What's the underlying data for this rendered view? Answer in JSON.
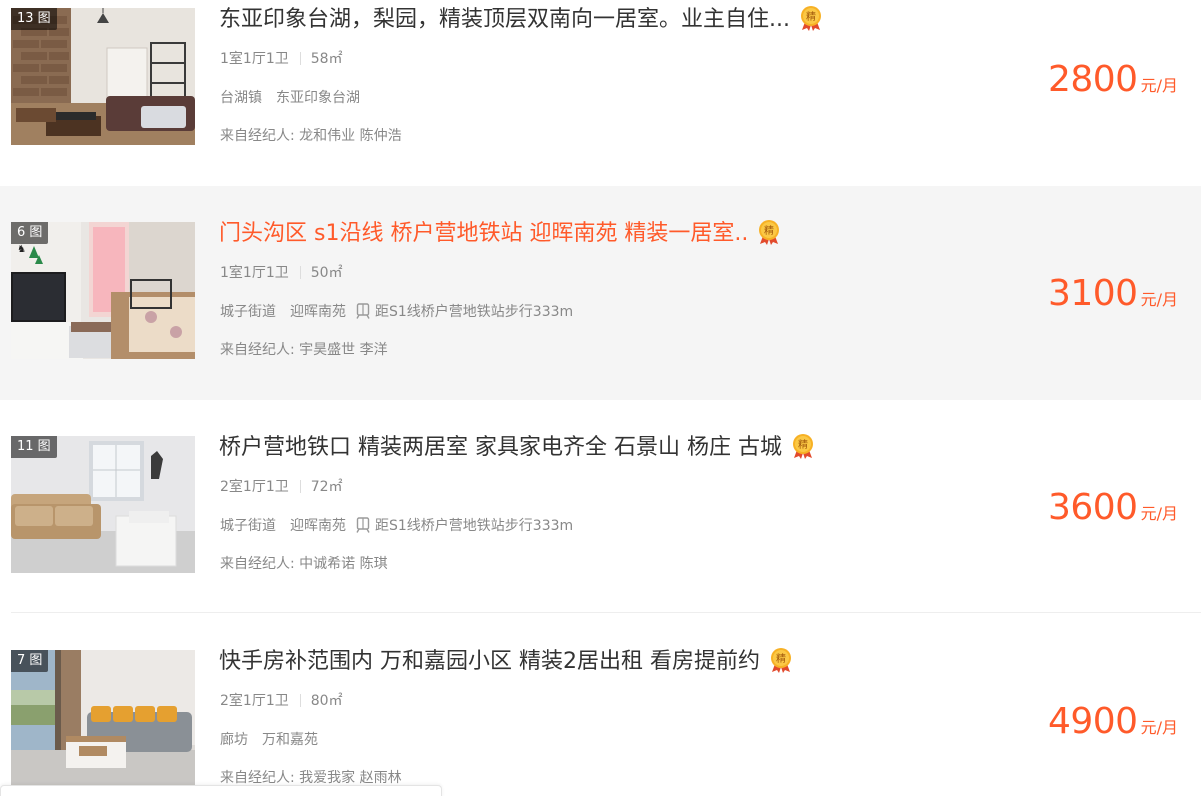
{
  "listings": [
    {
      "pic_count": "13 图",
      "title": "东亚印象台湖，梨园，精装顶层双南向一居室。业主自住...",
      "layout": "1室1厅1卫",
      "area": "58㎡",
      "location": [
        "台湖镇",
        "东亚印象台湖"
      ],
      "subway": "",
      "agent": "来自经纪人: 龙和伟业 陈仲浩",
      "price": "2800",
      "price_unit": "元/月",
      "badge": "精"
    },
    {
      "pic_count": "6 图",
      "title": "门头沟区 s1沿线 桥户营地铁站 迎晖南苑 精装一居室..",
      "layout": "1室1厅1卫",
      "area": "50㎡",
      "location": [
        "城子街道",
        "迎晖南苑"
      ],
      "subway": "距S1线桥户营地铁站步行333m",
      "agent": "来自经纪人: 宇昊盛世 李洋",
      "price": "3100",
      "price_unit": "元/月",
      "badge": "精"
    },
    {
      "pic_count": "11 图",
      "title": "桥户营地铁口 精装两居室 家具家电齐全 石景山 杨庄 古城",
      "layout": "2室1厅1卫",
      "area": "72㎡",
      "location": [
        "城子街道",
        "迎晖南苑"
      ],
      "subway": "距S1线桥户营地铁站步行333m",
      "agent": "来自经纪人: 中诚希诺 陈琪",
      "price": "3600",
      "price_unit": "元/月",
      "badge": "精"
    },
    {
      "pic_count": "7 图",
      "title": "快手房补范围内 万和嘉园小区 精装2居出租 看房提前约",
      "layout": "2室1厅1卫",
      "area": "80㎡",
      "location": [
        "廊坊",
        "万和嘉苑"
      ],
      "subway": "",
      "agent": "来自经纪人: 我爱我家 赵雨林",
      "price": "4900",
      "price_unit": "元/月",
      "badge": "精"
    }
  ],
  "colors": {
    "accent": "#ff5a2a",
    "title_text": "#333333",
    "meta_text": "#888888",
    "hover_bg": "#f5f5f5"
  }
}
